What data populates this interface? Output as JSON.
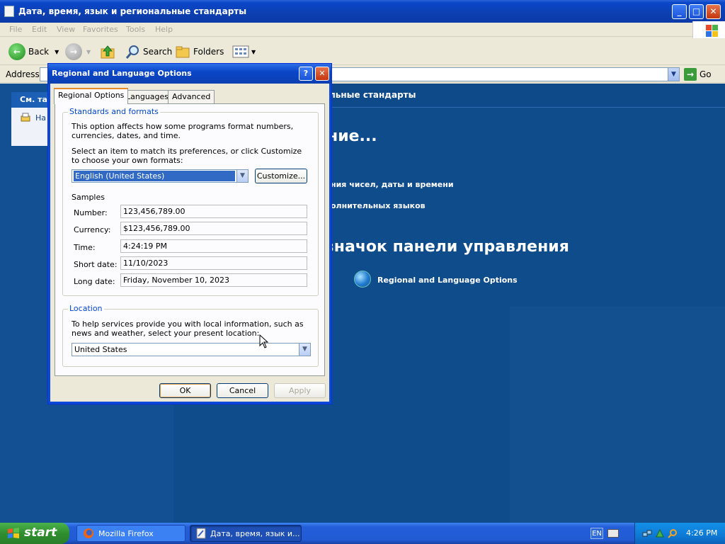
{
  "explorer": {
    "title": "Дата, время, язык и региональные стандарты",
    "menu": [
      "File",
      "Edit",
      "View",
      "Favorites",
      "Tools",
      "Help"
    ],
    "toolbar": {
      "back": "Back",
      "search": "Search",
      "folders": "Folders"
    },
    "address_label": "Address",
    "go_label": "Go"
  },
  "content": {
    "left_panel_header": "См. так",
    "left_panel_item": "На",
    "header": "льные стандарты",
    "heading1": "ние...",
    "link1": "ния чисел, даты и времени",
    "link2": "олнительных языков",
    "heading2": "значок панели управления",
    "control_panel_icon": "Regional and Language Options"
  },
  "dialog": {
    "title": "Regional and Language Options",
    "help_button": "?",
    "close_button": "✕",
    "tabs": [
      "Regional Options",
      "Languages",
      "Advanced"
    ],
    "standards": {
      "group_label": "Standards and formats",
      "description": "This option affects how some programs format numbers, currencies, dates, and time.",
      "instruction": "Select an item to match its preferences, or click Customize to choose your own formats:",
      "selected_format": "English (United States)",
      "customize_button": "Customize...",
      "samples_label": "Samples",
      "samples": [
        {
          "label": "Number:",
          "value": "123,456,789.00"
        },
        {
          "label": "Currency:",
          "value": "$123,456,789.00"
        },
        {
          "label": "Time:",
          "value": "4:24:19 PM"
        },
        {
          "label": "Short date:",
          "value": "11/10/2023"
        },
        {
          "label": "Long date:",
          "value": "Friday, November 10, 2023"
        }
      ]
    },
    "location": {
      "group_label": "Location",
      "description": "To help services provide you with local information, such as news and weather, select your present location:",
      "selected": "United States"
    },
    "buttons": {
      "ok": "OK",
      "cancel": "Cancel",
      "apply": "Apply"
    }
  },
  "taskbar": {
    "start": "start",
    "tasks": [
      "Mozilla Firefox",
      "Дата, время, язык и..."
    ],
    "language": "EN",
    "clock": "4:26 PM"
  }
}
